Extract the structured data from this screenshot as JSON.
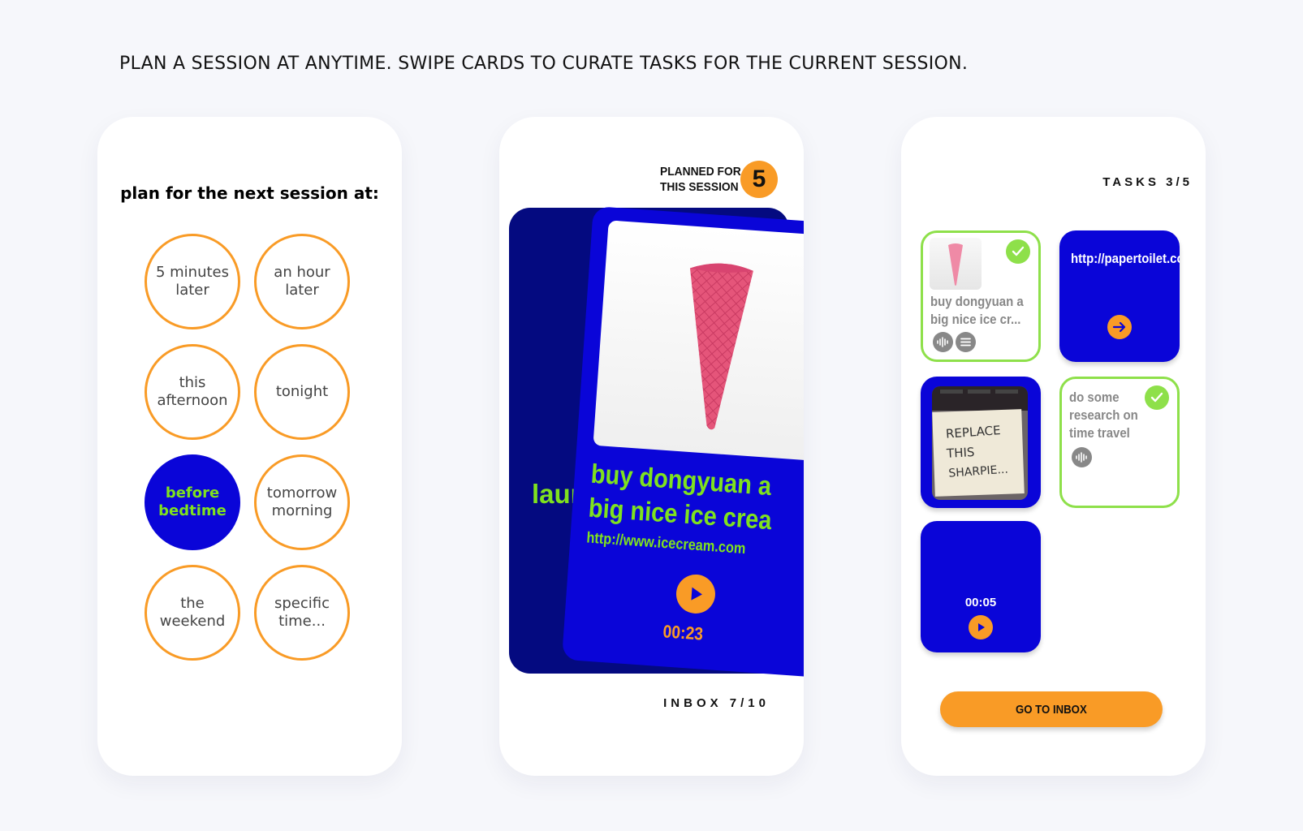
{
  "headline": "PLAN A SESSION AT ANYTIME. SWIPE CARDS TO CURATE TASKS FOR THE CURRENT SESSION.",
  "colors": {
    "brand_blue": "#0a05d8",
    "navy": "#040a80",
    "accent_orange": "#f99b26",
    "accent_green": "#7fe21e",
    "check_green": "#8ee04a"
  },
  "plan_screen": {
    "title": "plan for the next session at:",
    "options": [
      {
        "label": "5 minutes later",
        "selected": false
      },
      {
        "label": "an hour later",
        "selected": false
      },
      {
        "label": "this afternoon",
        "selected": false
      },
      {
        "label": "tonight",
        "selected": false
      },
      {
        "label": "before bedtime",
        "selected": true
      },
      {
        "label": "tomorrow morning",
        "selected": false
      },
      {
        "label": "the weekend",
        "selected": false
      },
      {
        "label": "specific time...",
        "selected": false
      }
    ]
  },
  "swipe_screen": {
    "planned_label_line1": "PLANNED FOR",
    "planned_label_line2": "THIS SESSION",
    "planned_count": "5",
    "back_card_text": "launc",
    "front_card": {
      "title_line1": "buy dongyuan a",
      "title_line2": "big nice ice crea",
      "url": "http://www.icecream.com",
      "duration": "00:23",
      "image": "pink-waffle-cone",
      "play_icon": "play-icon"
    },
    "inbox_count": "INBOX 7/10"
  },
  "tasks_screen": {
    "tasks_count": "TASKS 3/5",
    "tiles": [
      {
        "type": "note",
        "text": "buy dongyuan a big nice ice cr...",
        "checked": true,
        "icons": [
          "audio-waveform-icon",
          "list-icon"
        ]
      },
      {
        "type": "link",
        "text": "http://papertoilet.com/",
        "checked": false,
        "icons": [
          "arrow-right-icon"
        ]
      },
      {
        "type": "photo",
        "handwriting": "REPLACE THIS SHARPIE...",
        "checked": false
      },
      {
        "type": "note",
        "text": "do some research on time travel",
        "checked": true,
        "icons": [
          "audio-waveform-icon"
        ]
      },
      {
        "type": "audio",
        "duration": "00:05",
        "checked": false,
        "icons": [
          "play-icon"
        ]
      }
    ],
    "button_label": "GO TO INBOX"
  }
}
